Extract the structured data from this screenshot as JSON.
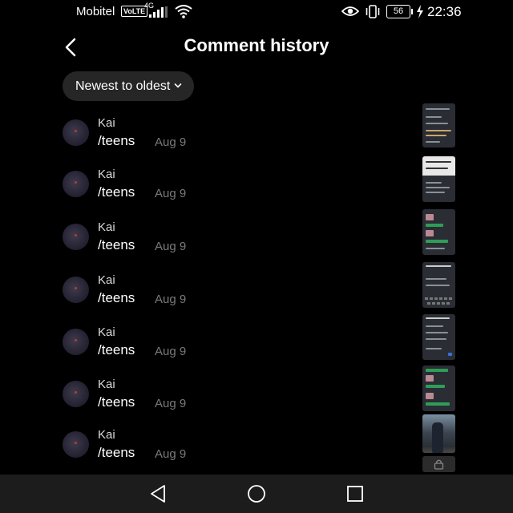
{
  "status_bar": {
    "carrier": "Mobitel",
    "volte": "VoLTE",
    "network": "4G",
    "battery": "56",
    "time": "22:36",
    "icons": [
      "signal-icon",
      "wifi-icon",
      "eye-icon",
      "vibrate-icon",
      "battery-icon",
      "charging-icon"
    ]
  },
  "header": {
    "title": "Comment history",
    "back_icon": "back-arrow-icon"
  },
  "sort": {
    "label": "Newest to oldest",
    "icon": "chevron-down-icon"
  },
  "comments": [
    {
      "user": "Kai",
      "text": "/teens",
      "date": "Aug 9"
    },
    {
      "user": "Kai",
      "text": "/teens",
      "date": "Aug 9"
    },
    {
      "user": "Kai",
      "text": "/teens",
      "date": "Aug 9"
    },
    {
      "user": "Kai",
      "text": "/teens",
      "date": "Aug 9"
    },
    {
      "user": "Kai",
      "text": "/teens",
      "date": "Aug 9"
    },
    {
      "user": "Kai",
      "text": "/teens",
      "date": "Aug 9"
    },
    {
      "user": "Kai",
      "text": "/teens",
      "date": "Aug 9"
    }
  ],
  "nav_bar": {
    "icons": [
      "nav-back-icon",
      "nav-home-icon",
      "nav-recents-icon"
    ]
  }
}
